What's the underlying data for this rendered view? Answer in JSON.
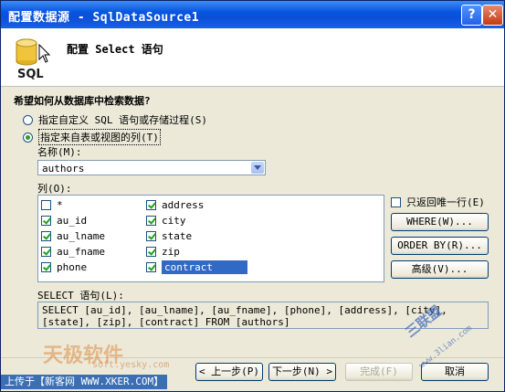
{
  "window": {
    "title": "配置数据源 - SqlDataSource1",
    "help_glyph": "?",
    "close_glyph": "✕"
  },
  "header": {
    "title": "配置 Select 语句",
    "icon": "database-sql-icon",
    "icon_text": "SQL"
  },
  "question": "希望如何从数据库中检索数据?",
  "options": {
    "custom_sql": "指定自定义 SQL 语句或存储过程(S)",
    "table_view": "指定来自表或视图的列(T)",
    "selected": "table_view"
  },
  "name_label": "名称(M):",
  "name_value": "authors",
  "columns_label": "列(O):",
  "columns": [
    {
      "label": "*",
      "checked": false
    },
    {
      "label": "au_id",
      "checked": true
    },
    {
      "label": "au_lname",
      "checked": true
    },
    {
      "label": "au_fname",
      "checked": true
    },
    {
      "label": "phone",
      "checked": true
    },
    {
      "label": "address",
      "checked": true
    },
    {
      "label": "city",
      "checked": true
    },
    {
      "label": "state",
      "checked": true
    },
    {
      "label": "zip",
      "checked": true
    },
    {
      "label": "contract",
      "checked": true,
      "selected": true
    }
  ],
  "unique_rows": {
    "label": "只返回唯一行(E)",
    "checked": false
  },
  "buttons": {
    "where": "WHERE(W)...",
    "order_by": "ORDER BY(R)...",
    "advanced": "高级(V)...",
    "prev": "< 上一步(P)",
    "next": "下一步(N) >",
    "finish": "完成(F)",
    "cancel": "取消"
  },
  "sql_label": "SELECT 语句(L):",
  "sql_text": "SELECT [au_id], [au_lname], [au_fname], [phone], [address], [city], [state], [zip], [contract] FROM [authors]",
  "watermarks": {
    "upload": "上传于【新客网 WWW.XKER.COM】",
    "tianji": "天极软件",
    "tianji_url": "soft.yesky.com",
    "sanyou": "三联盟",
    "sanyou_url": "www.3lian.com"
  },
  "colors": {
    "title_bar": "#0a4fd6",
    "dialog_bg": "#ece9d8",
    "selection": "#316ac5",
    "check": "#21a121"
  }
}
